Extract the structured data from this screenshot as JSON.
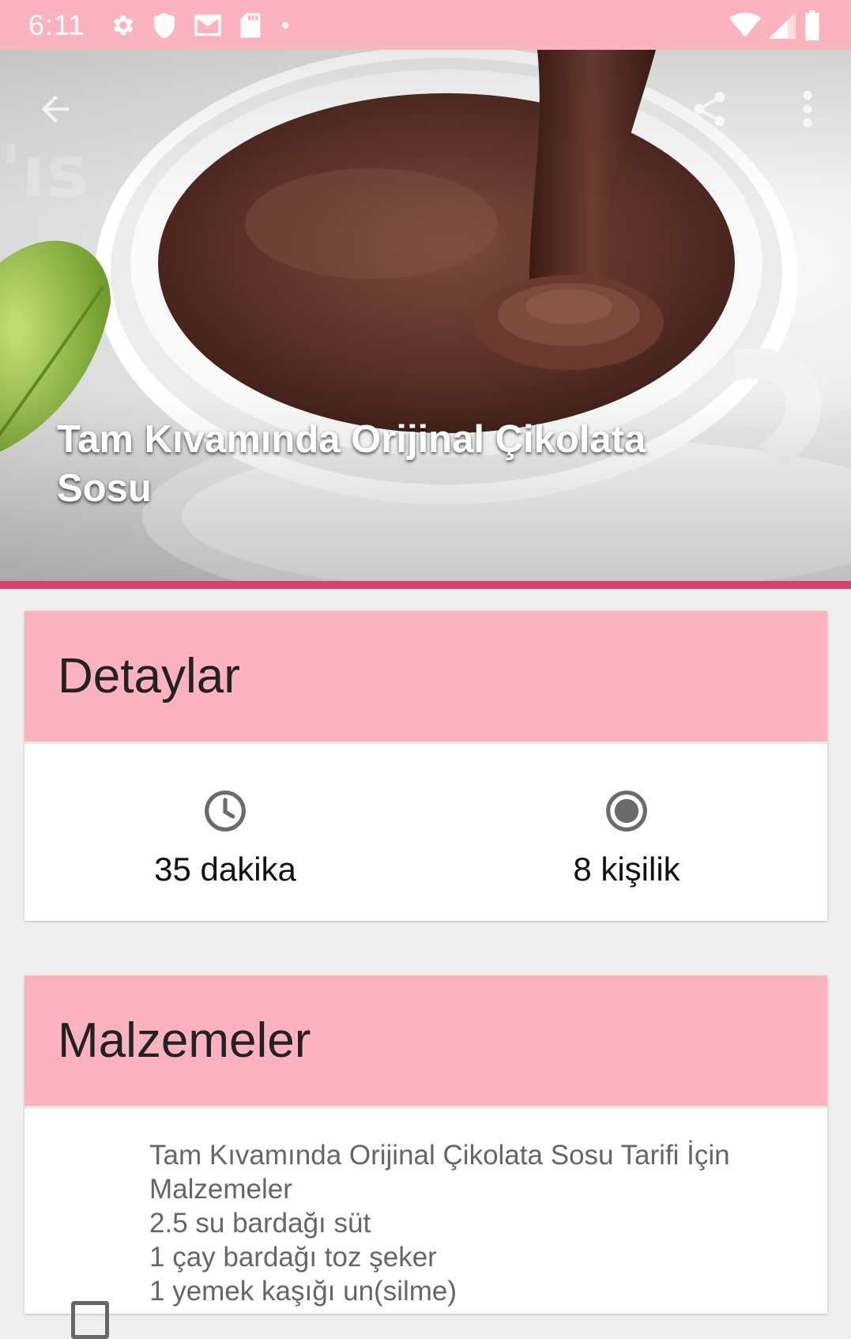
{
  "status_bar": {
    "time": "6:11",
    "left_icons": [
      "gear-icon",
      "shield-icon",
      "mail-icon",
      "sd-card-icon",
      "dot-icon"
    ],
    "right_icons": [
      "wifi-icon",
      "signal-icon",
      "battery-icon"
    ]
  },
  "toolbar": {
    "back_icon": "arrow-left-icon",
    "share_icon": "share-icon",
    "more_icon": "more-vert-icon"
  },
  "hero": {
    "title": "Tam Kıvamında Orijinal Çikolata Sosu"
  },
  "details": {
    "header": "Detaylar",
    "time_value": "35 dakika",
    "servings_value": "8 kişilik"
  },
  "ingredients": {
    "header": "Malzemeler",
    "items": [
      "Tam Kıvamında Orijinal Çikolata Sosu Tarifi İçin Malzemeler",
      "2.5 su bardağı süt",
      "1 çay bardağı toz şeker",
      "1 yemek kaşığı un(silme)"
    ]
  },
  "colors": {
    "status_bar": "#fbb3bf",
    "card_header": "#fcb3bf",
    "accent_bar": "#d6406d",
    "background": "#efefef"
  }
}
